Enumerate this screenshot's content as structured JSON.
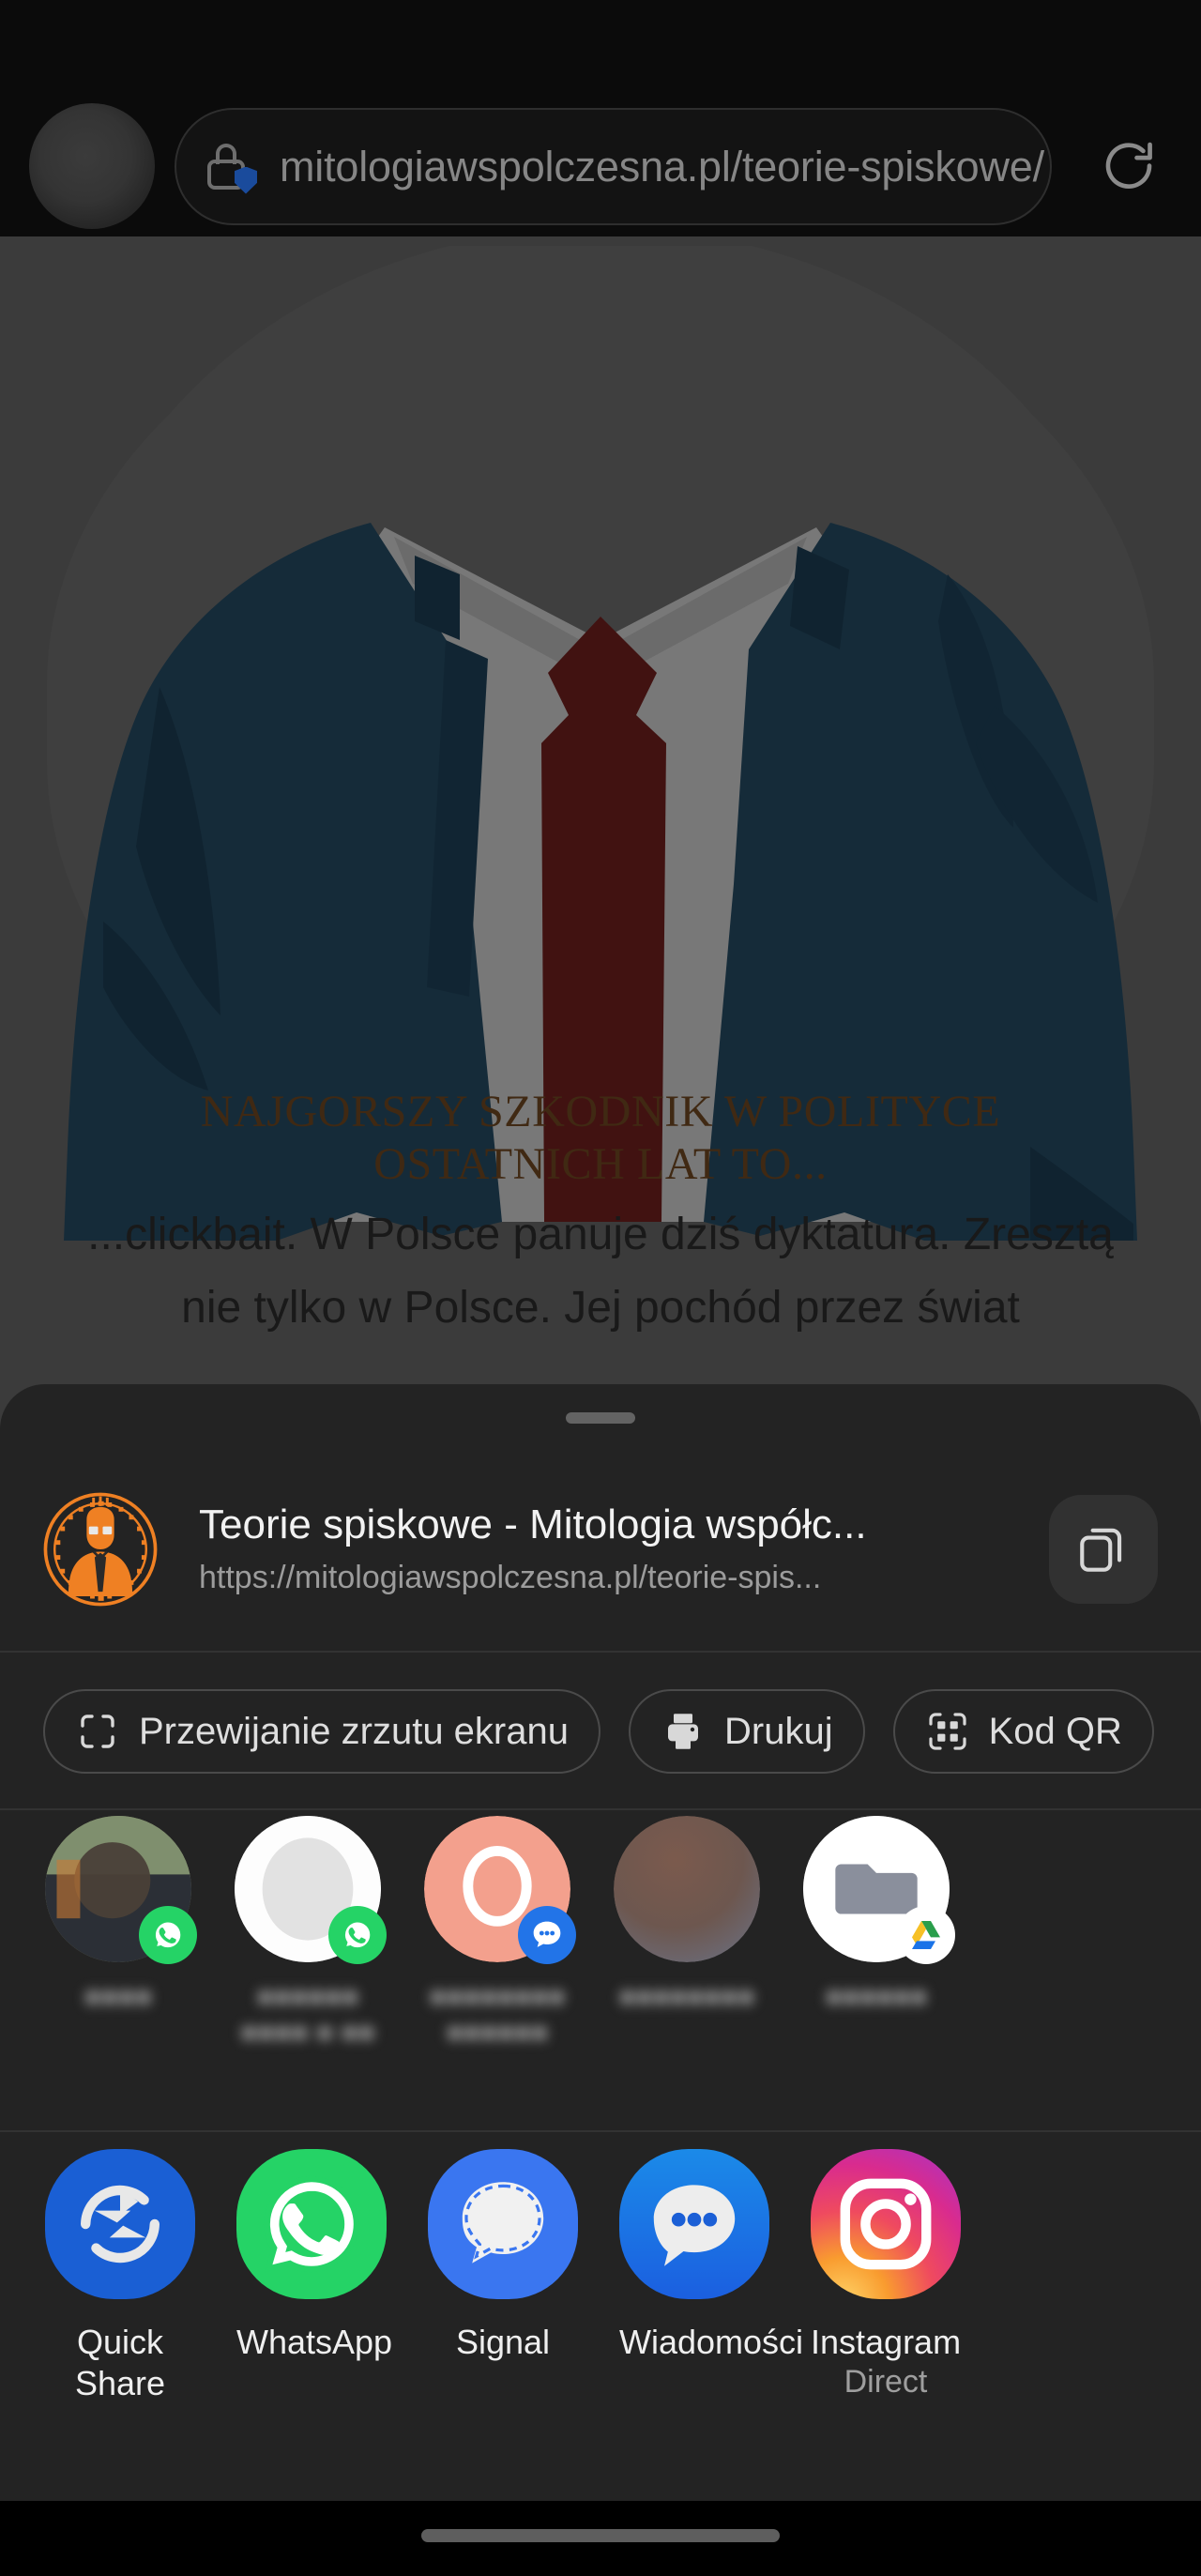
{
  "browser": {
    "url": "mitologiawspolczesna.pl/teorie-spiskowe/",
    "lock_icon": "lock-shield-icon",
    "reload_icon": "reload-icon",
    "tab_avatar_icon": "tab-avatar-icon"
  },
  "page": {
    "headline": "NAJGORSZY SZKODNIK W POLITYCE OSTATNICH LAT TO...",
    "paragraph": "...clickbait. W Polsce panuje dziś dyktatura. Zresztą nie tylko w Polsce. Jej pochód przez świat",
    "headline_color": "#6b4520",
    "illustration": "suit-and-tie-illustration"
  },
  "sheet": {
    "preview": {
      "title": "Teorie spiskowe - Mitologia współc...",
      "url": "https://mitologiawspolczesna.pl/teorie-spis...",
      "favicon_icon": "site-favicon-greek-meander-man",
      "copy_icon": "copy-icon"
    },
    "chips": [
      {
        "label": "Przewijanie zrzutu ekranu",
        "icon": "scroll-capture-icon"
      },
      {
        "label": "Drukuj",
        "icon": "printer-icon"
      },
      {
        "label": "Kod QR",
        "icon": "qr-code-icon"
      }
    ],
    "contacts": [
      {
        "name": "●●●●",
        "badge": "whatsapp-badge",
        "avatar": "photo-avatar"
      },
      {
        "name": "●●●●●●\n●●●● ● ●●",
        "badge": "whatsapp-badge",
        "avatar": "default-person-avatar"
      },
      {
        "name": "●●●●●●●●\n●●●●●●",
        "badge": "messages-badge",
        "avatar": "initial-avatar"
      },
      {
        "name": "●●●●●●●●",
        "badge": "none",
        "avatar": "photo-avatar"
      },
      {
        "name": "●●●●●●",
        "badge": "drive-badge",
        "avatar": "folder-avatar"
      }
    ],
    "apps": [
      {
        "label": "Quick Share",
        "sub": "",
        "icon": "quick-share-icon"
      },
      {
        "label": "WhatsApp",
        "sub": "",
        "icon": "whatsapp-icon"
      },
      {
        "label": "Signal",
        "sub": "",
        "icon": "signal-icon"
      },
      {
        "label": "Wiadomości",
        "sub": "",
        "icon": "messages-icon"
      },
      {
        "label": "Instagram",
        "sub": "Direct",
        "icon": "instagram-icon"
      }
    ]
  },
  "navbar": {
    "gesture_pill": "gesture-nav-pill"
  }
}
